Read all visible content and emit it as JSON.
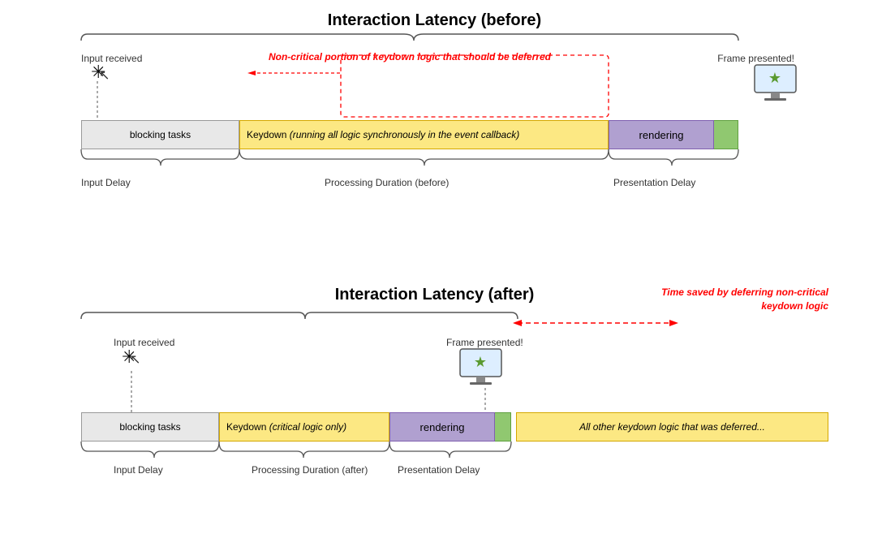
{
  "top": {
    "title": "Interaction Latency (before)",
    "input_received": "Input received",
    "frame_presented": "Frame presented!",
    "annotation_red": "Non-critical portion of keydown\nlogic that should be deferred",
    "bar_blocking": "blocking tasks",
    "bar_keydown": "Keydown (running all logic synchronously in the event callback)",
    "bar_rendering": "rendering",
    "label_input_delay": "Input Delay",
    "label_processing": "Processing Duration (before)",
    "label_presentation": "Presentation Delay"
  },
  "bottom": {
    "title": "Interaction Latency (after)",
    "time_saved": "Time saved by deferring\nnon-critical keydown logic",
    "input_received": "Input received",
    "frame_presented": "Frame presented!",
    "bar_blocking": "blocking tasks",
    "bar_keydown": "Keydown (critical logic only)",
    "bar_rendering": "rendering",
    "bar_deferred": "All other keydown logic that was deferred...",
    "label_input_delay": "Input Delay",
    "label_processing": "Processing Duration (after)",
    "label_presentation": "Presentation Delay"
  }
}
